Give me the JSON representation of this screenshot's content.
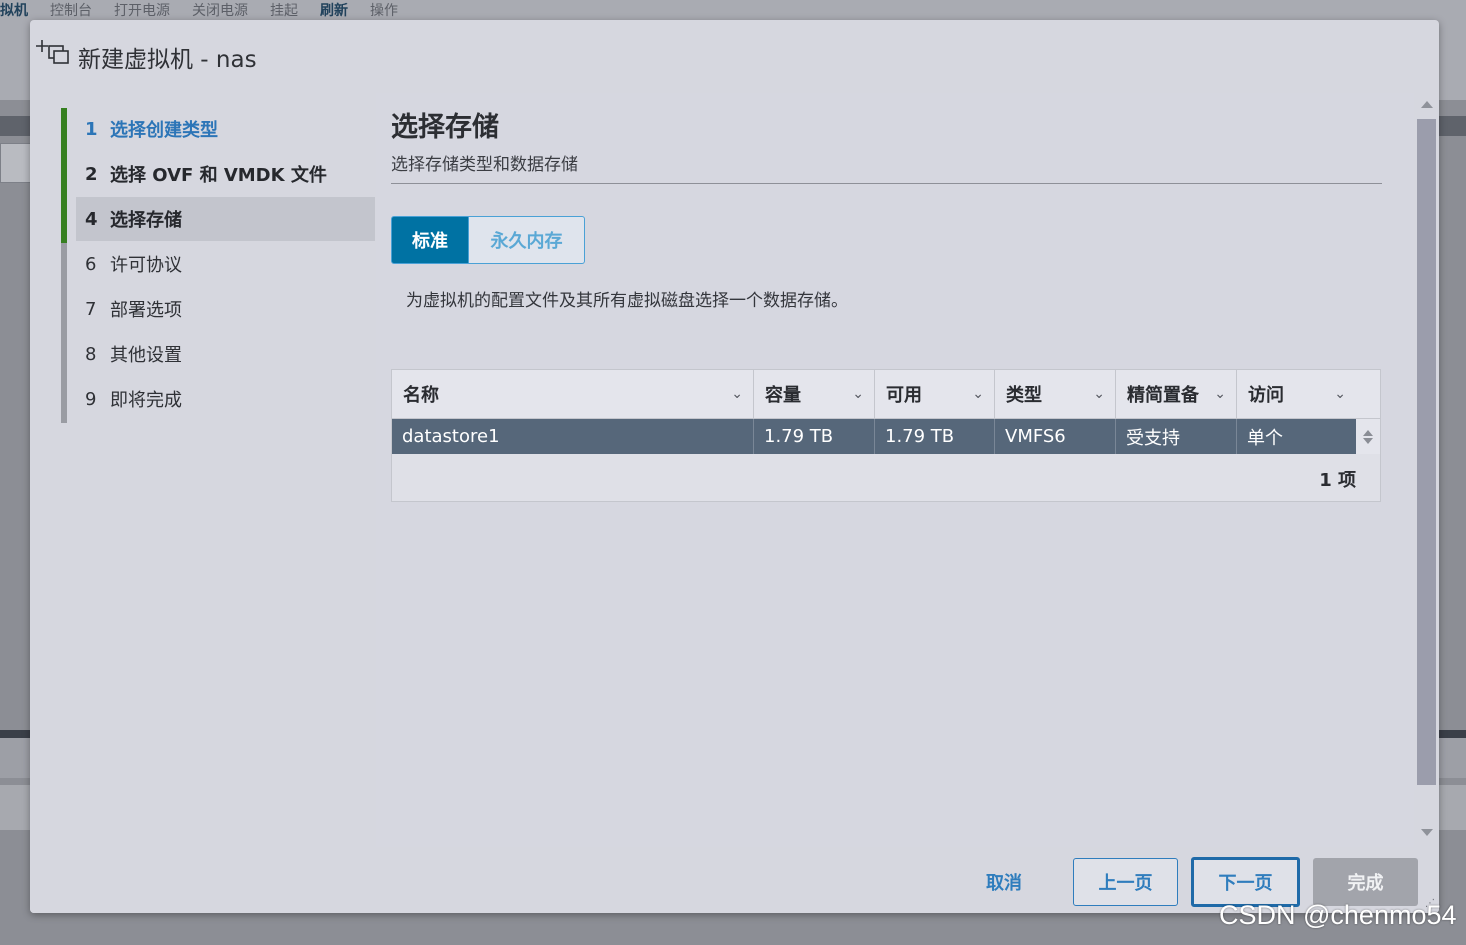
{
  "background": {
    "toolbar": [
      "拟机",
      "控制台",
      "打开电源",
      "关闭电源",
      "挂起",
      "刷新",
      "操作"
    ]
  },
  "dialog": {
    "title": "新建虚拟机 - nas",
    "icon": "new-vm-icon"
  },
  "steps": [
    {
      "num": "1",
      "label": "选择创建类型",
      "state": "link"
    },
    {
      "num": "2",
      "label": "选择 OVF 和 VMDK 文件",
      "state": "done"
    },
    {
      "num": "4",
      "label": "选择存储",
      "state": "active"
    },
    {
      "num": "6",
      "label": "许可协议",
      "state": "pending"
    },
    {
      "num": "7",
      "label": "部署选项",
      "state": "pending"
    },
    {
      "num": "8",
      "label": "其他设置",
      "state": "pending"
    },
    {
      "num": "9",
      "label": "即将完成",
      "state": "pending"
    }
  ],
  "main": {
    "title": "选择存储",
    "subtitle": "选择存储类型和数据存储",
    "tabs": [
      {
        "label": "标准",
        "selected": true
      },
      {
        "label": "永久内存",
        "selected": false
      }
    ],
    "description": "为虚拟机的配置文件及其所有虚拟磁盘选择一个数据存储。"
  },
  "grid": {
    "columns": [
      "名称",
      "容量",
      "可用",
      "类型",
      "精简置备",
      "访问"
    ],
    "rows": [
      [
        "datastore1",
        "1.79 TB",
        "1.79 TB",
        "VMFS6",
        "受支持",
        "单个"
      ]
    ],
    "footer": "1 项"
  },
  "footer": {
    "cancel": "取消",
    "prev": "上一页",
    "next": "下一页",
    "finish": "完成"
  },
  "watermark": "CSDN @chenmo54",
  "colors": {
    "accent": "#0072a3",
    "link": "#2f7dbd",
    "completed_rail": "#367f20",
    "selected_row": "#56677a"
  }
}
